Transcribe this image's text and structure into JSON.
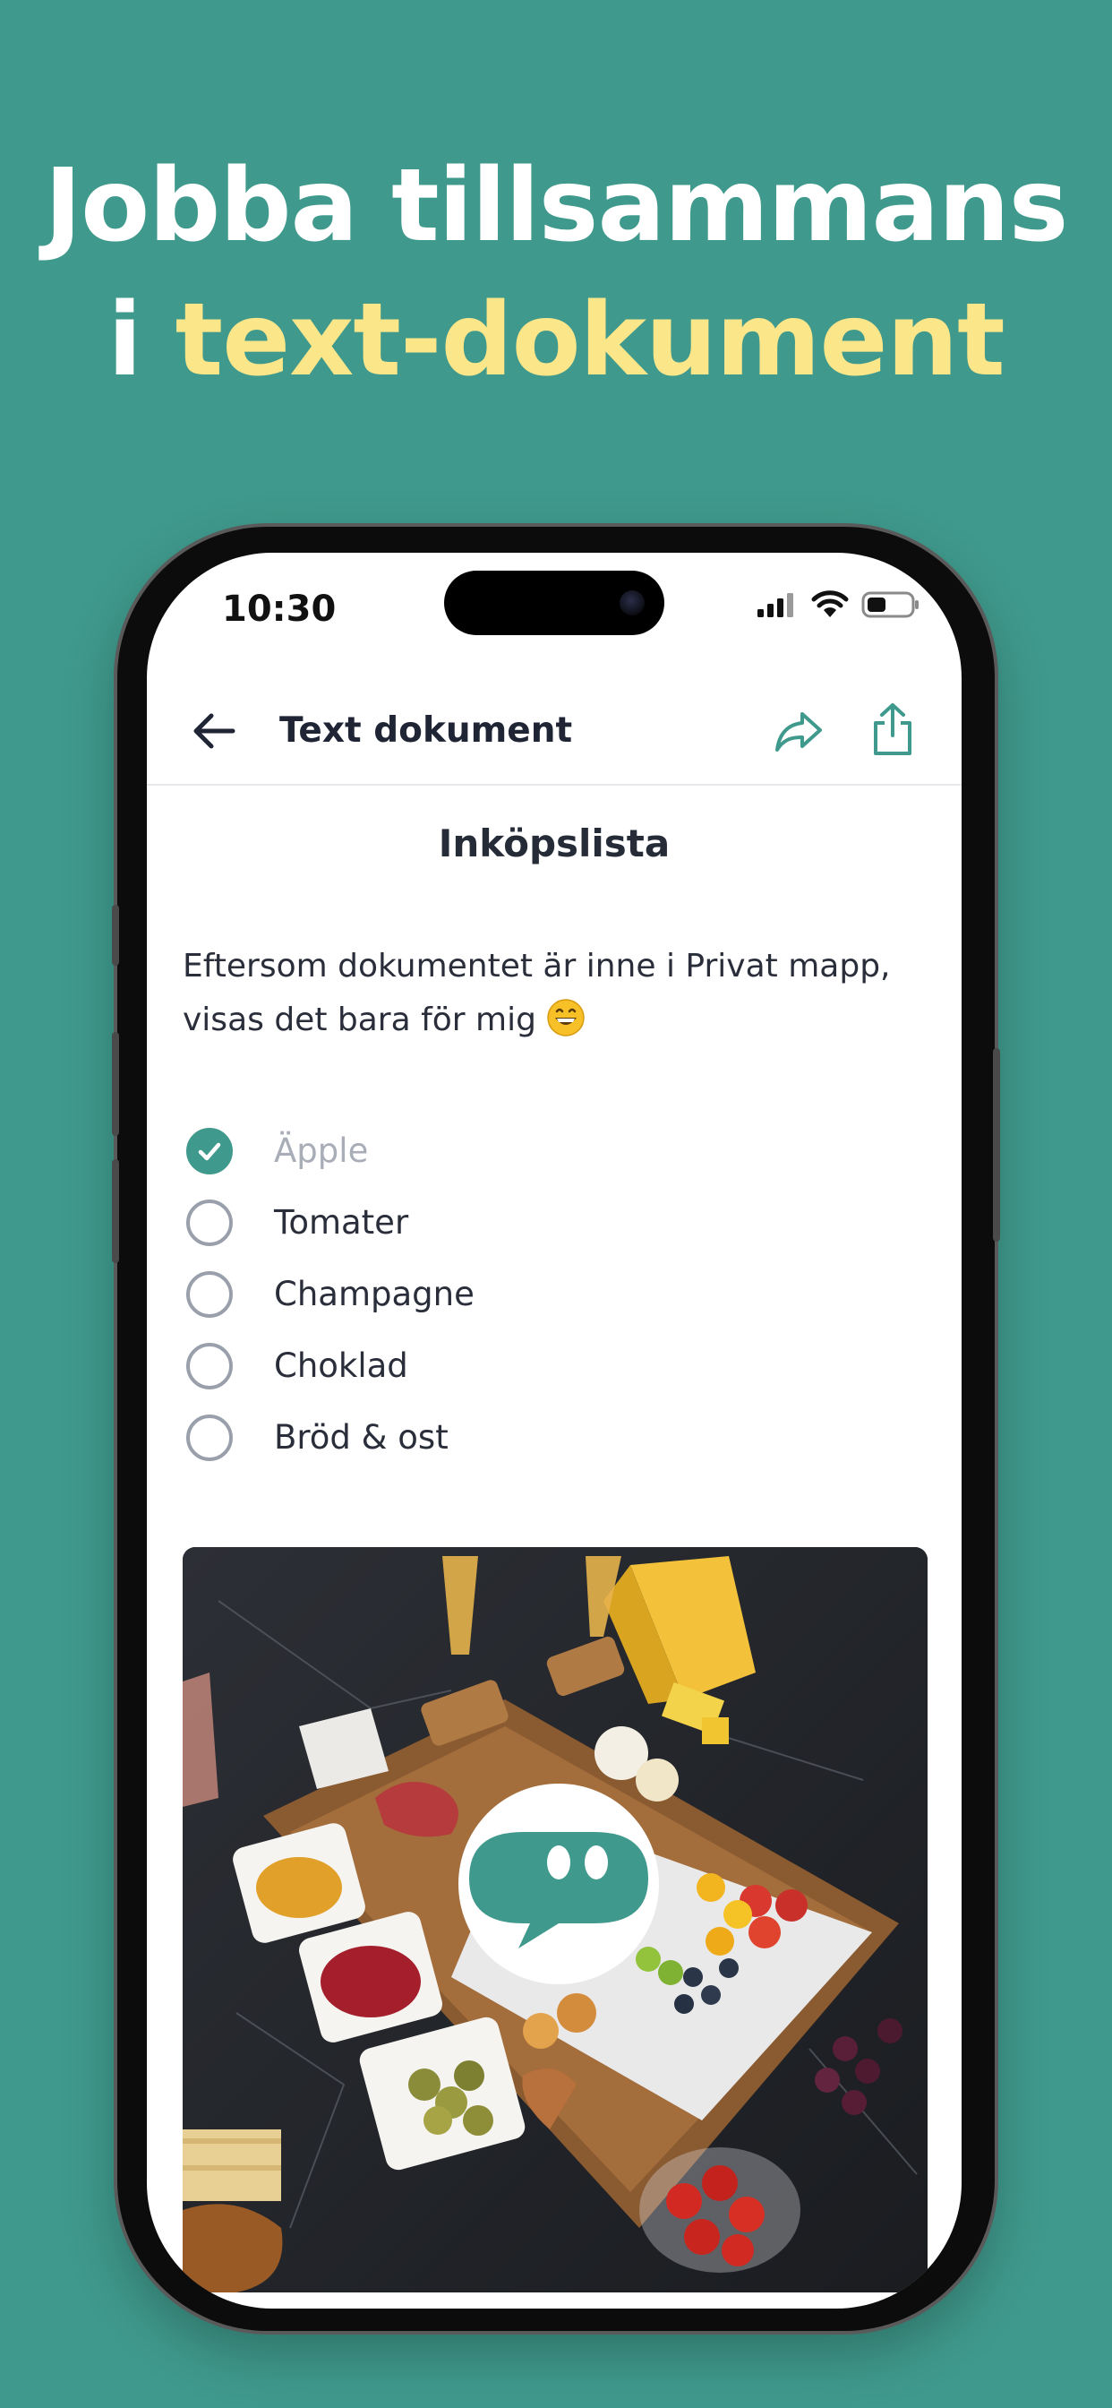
{
  "headline": {
    "line1": "Jobba tillsammans",
    "line2_prefix": "i ",
    "line2_accent": "text-dokument"
  },
  "colors": {
    "background": "#3f998c",
    "accent_text": "#fce68a",
    "brand": "#3f998c"
  },
  "status_bar": {
    "time": "10:30"
  },
  "app_bar": {
    "title": "Text dokument",
    "back_icon": "arrow-left-icon",
    "forward_icon": "forward-arrow-icon",
    "share_icon": "share-icon"
  },
  "document": {
    "title": "Inköpslista",
    "paragraph": "Eftersom dokumentet är inne i Privat mapp, visas det bara för mig",
    "paragraph_emoji": "grinning-face-icon",
    "checklist": [
      {
        "label": "Äpple",
        "checked": true
      },
      {
        "label": "Tomater",
        "checked": false
      },
      {
        "label": "Champagne",
        "checked": false
      },
      {
        "label": "Choklad",
        "checked": false
      },
      {
        "label": "Bröd & ost",
        "checked": false
      }
    ],
    "image_icon": "speech-bubble-logo-icon"
  }
}
